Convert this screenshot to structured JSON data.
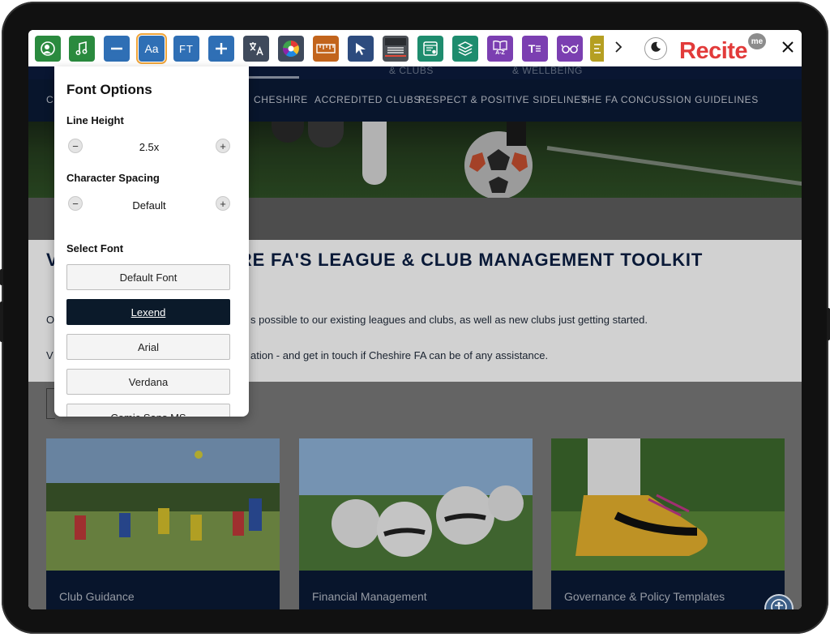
{
  "toolbar": {
    "buttons": [
      {
        "name": "screen-reader-button",
        "icon": "speech-head-icon",
        "color": "#2a8a3e"
      },
      {
        "name": "audio-settings-button",
        "icon": "music-note-icon",
        "color": "#2a8a3e"
      },
      {
        "name": "decrease-text-button",
        "icon": "minus-icon",
        "color": "#2f6fb5"
      },
      {
        "name": "font-options-button",
        "label": "Aa",
        "icon": "text-size-icon",
        "color": "#2f6fb5"
      },
      {
        "name": "font-type-button",
        "label": "FT",
        "icon": "font-type-icon",
        "color": "#2f6fb5"
      },
      {
        "name": "increase-text-button",
        "icon": "plus-icon",
        "color": "#2f6fb5"
      },
      {
        "name": "translate-button",
        "icon": "translate-icon",
        "color": "#3f4a5c"
      },
      {
        "name": "color-settings-button",
        "icon": "color-wheel-icon",
        "color": "#3f4a5c"
      },
      {
        "name": "ruler-button",
        "icon": "ruler-icon",
        "color": "#c2641c"
      },
      {
        "name": "cursor-button",
        "icon": "cursor-arrow-icon",
        "color": "#2d4b7e"
      },
      {
        "name": "screen-mask-button",
        "icon": "screen-mask-icon",
        "color": "#4b4f55"
      },
      {
        "name": "text-only-button",
        "icon": "text-only-icon",
        "color": "#1e8c6e"
      },
      {
        "name": "page-layers-button",
        "icon": "layers-icon",
        "color": "#1e8c6e"
      },
      {
        "name": "dictionary-button",
        "label": "A-Z",
        "icon": "dictionary-icon",
        "color": "#7b3fb1"
      },
      {
        "name": "magnifier-text-button",
        "label": "T",
        "icon": "magnify-text-icon",
        "color": "#7b3fb1"
      },
      {
        "name": "reading-glasses-button",
        "icon": "glasses-icon",
        "color": "#7b3fb1"
      },
      {
        "name": "partial-button",
        "icon": "partial-icon",
        "color": "#b59f22"
      }
    ],
    "brand": {
      "name": "Recite",
      "badge": "me"
    }
  },
  "panel": {
    "title": "Font Options",
    "line_height_label": "Line Height",
    "line_height_value": "2.5x",
    "char_spacing_label": "Character Spacing",
    "char_spacing_value": "Default",
    "select_font_label": "Select Font",
    "fonts": [
      "Default Font",
      "Lexend",
      "Arial",
      "Verdana",
      "Comic Sans MS"
    ],
    "selected_font": "Lexend"
  },
  "site": {
    "topbar_items": [
      "& CLUBS",
      "& WELLBEING"
    ],
    "nav": [
      "C",
      "CHESHIRE",
      "ACCREDITED CLUBS",
      "RESPECT & POSITIVE SIDELINES",
      "THE FA CONCUSSION GUIDELINES"
    ],
    "headline_start": "V",
    "headline_rest": "IRE FA'S LEAGUE & CLUB MANAGEMENT TOOLKIT",
    "para1_start": "O",
    "para1_rest": "s possible to our existing leagues and clubs, as well as new clubs just getting started.",
    "para2_start": "V",
    "para2_rest": "ation - and get in touch if Cheshire FA can be of any assistance.",
    "cards": [
      {
        "label": "Club Guidance"
      },
      {
        "label": "Financial Management"
      },
      {
        "label": "Governance & Policy Templates"
      }
    ]
  }
}
